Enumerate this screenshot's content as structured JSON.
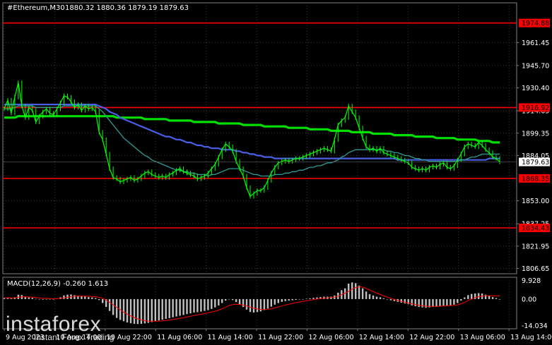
{
  "header": {
    "symbol_label": "#Ethereum,M30",
    "ohlc": "1880.32 1880.36 1879.19 1879.63"
  },
  "colors": {
    "background": "#000000",
    "candle": "#00ff00",
    "ma_fast": "#2f9b96",
    "ma_mid": "#4b5fe6",
    "ma_slow": "#00e000",
    "level": "#ff0000",
    "macd_hist": "#c0c0c0",
    "macd_signal": "#ff0000"
  },
  "chart_data": [
    {
      "type": "line",
      "title": "",
      "price_axis_ticks": [
        "1961.45",
        "1945.70",
        "1930.40",
        "1914.65",
        "1899.35",
        "1884.05",
        "1853.00",
        "1837.25",
        "1821.95",
        "1806.65"
      ],
      "time_axis_labels": [
        "9 Aug 2023",
        "10 Aug 14:00",
        "10 Aug 22:00",
        "11 Aug 06:00",
        "11 Aug 14:00",
        "11 Aug 22:00",
        "12 Aug 06:00",
        "12 Aug 14:00",
        "12 Aug 22:00",
        "13 Aug 06:00",
        "13 Aug 14:00"
      ],
      "ylim": [
        1803,
        1980
      ],
      "levels": [
        {
          "label": "1974.88",
          "value": 1974.88
        },
        {
          "label": "1916.92",
          "value": 1916.92
        },
        {
          "label": "1868.35",
          "value": 1868.35
        },
        {
          "label": "1834.43",
          "value": 1834.43
        }
      ],
      "current_price": {
        "label": "1879.63",
        "value": 1879.63
      },
      "series": [
        {
          "key": "close",
          "values": [
            1916,
            1922,
            1913,
            1924,
            1934,
            1918,
            1910,
            1917,
            1915,
            1907,
            1911,
            1914,
            1916,
            1913,
            1912,
            1916,
            1920,
            1925,
            1924,
            1921,
            1917,
            1919,
            1915,
            1918,
            1916,
            1917,
            1914,
            1900,
            1895,
            1885,
            1875,
            1869,
            1868,
            1866,
            1867,
            1868,
            1869,
            1867,
            1868,
            1870,
            1872,
            1873,
            1871,
            1870,
            1869,
            1870,
            1869,
            1871,
            1872,
            1874,
            1875,
            1873,
            1872,
            1871,
            1870,
            1868,
            1869,
            1870,
            1872,
            1875,
            1878,
            1883,
            1888,
            1892,
            1890,
            1887,
            1880,
            1875,
            1870,
            1862,
            1856,
            1858,
            1860,
            1860,
            1862,
            1867,
            1872,
            1876,
            1879,
            1880,
            1881,
            1880,
            1881,
            1882,
            1882,
            1883,
            1884,
            1885,
            1886,
            1887,
            1888,
            1889,
            1888,
            1887,
            1895,
            1905,
            1908,
            1910,
            1918,
            1914,
            1910,
            1903,
            1896,
            1890,
            1888,
            1889,
            1887,
            1889,
            1886,
            1885,
            1884,
            1883,
            1882,
            1881,
            1880,
            1879,
            1876,
            1875,
            1874,
            1875,
            1874,
            1876,
            1877,
            1876,
            1878,
            1879,
            1876,
            1875,
            1877,
            1881,
            1885,
            1890,
            1892,
            1891,
            1890,
            1893,
            1891,
            1888,
            1886,
            1883,
            1882,
            1879.63
          ]
        },
        {
          "key": "ma_fast",
          "values": [
            1916,
            1916,
            1916,
            1917,
            1918,
            1918,
            1918,
            1918,
            1918,
            1917,
            1917,
            1917,
            1917,
            1917,
            1917,
            1917,
            1917,
            1918,
            1918,
            1918,
            1918,
            1918,
            1918,
            1918,
            1918,
            1918,
            1918,
            1916,
            1914,
            1911,
            1908,
            1905,
            1902,
            1899,
            1896,
            1894,
            1892,
            1890,
            1888,
            1886,
            1884,
            1883,
            1881,
            1880,
            1879,
            1878,
            1877,
            1876,
            1875,
            1874,
            1874,
            1873,
            1873,
            1872,
            1872,
            1871,
            1871,
            1871,
            1870,
            1871,
            1871,
            1872,
            1873,
            1874,
            1875,
            1875,
            1875,
            1875,
            1874,
            1873,
            1872,
            1871,
            1871,
            1870,
            1870,
            1870,
            1870,
            1871,
            1871,
            1871,
            1872,
            1872,
            1873,
            1873,
            1874,
            1874,
            1875,
            1876,
            1876,
            1877,
            1877,
            1878,
            1879,
            1879,
            1880,
            1881,
            1883,
            1884,
            1886,
            1887,
            1888,
            1888,
            1888,
            1888,
            1888,
            1888,
            1888,
            1888,
            1888,
            1887,
            1887,
            1886,
            1886,
            1885,
            1884,
            1884,
            1883,
            1882,
            1882,
            1881,
            1881,
            1880,
            1880,
            1880,
            1880,
            1880,
            1880,
            1880,
            1880,
            1880,
            1881,
            1881,
            1882,
            1883,
            1883,
            1884,
            1885,
            1885,
            1885,
            1885,
            1885,
            1885
          ]
        },
        {
          "key": "ma_mid",
          "values": [
            1919,
            1919,
            1919,
            1919,
            1919,
            1919,
            1919,
            1919,
            1919,
            1919,
            1919,
            1919,
            1919,
            1919,
            1919,
            1919,
            1919,
            1919,
            1919,
            1919,
            1919,
            1919,
            1919,
            1919,
            1919,
            1919,
            1919,
            1918,
            1917,
            1916,
            1914,
            1913,
            1912,
            1910,
            1909,
            1908,
            1907,
            1906,
            1905,
            1904,
            1903,
            1902,
            1901,
            1900,
            1899,
            1898,
            1897,
            1897,
            1896,
            1895,
            1895,
            1894,
            1893,
            1893,
            1892,
            1891,
            1891,
            1890,
            1890,
            1889,
            1889,
            1889,
            1888,
            1888,
            1888,
            1888,
            1887,
            1887,
            1886,
            1886,
            1885,
            1885,
            1884,
            1884,
            1883,
            1883,
            1883,
            1882,
            1882,
            1882,
            1882,
            1882,
            1882,
            1882,
            1882,
            1882,
            1882,
            1882,
            1882,
            1882,
            1882,
            1882,
            1882,
            1882,
            1882,
            1882,
            1882,
            1882,
            1882,
            1882,
            1882,
            1882,
            1882,
            1882,
            1882,
            1882,
            1882,
            1882,
            1882,
            1882,
            1882,
            1882,
            1881,
            1881,
            1881,
            1881,
            1881,
            1881,
            1881,
            1881,
            1881,
            1881,
            1881,
            1881,
            1881,
            1881,
            1881,
            1881,
            1881,
            1881,
            1881,
            1881,
            1881,
            1881,
            1881,
            1881,
            1881,
            1881,
            1882,
            1882,
            1882,
            1882
          ]
        },
        {
          "key": "ma_slow",
          "values": [
            1910,
            1910,
            1910,
            1910,
            1911,
            1911,
            1911,
            1911,
            1911,
            1911,
            1911,
            1911,
            1911,
            1911,
            1911,
            1911,
            1911,
            1911,
            1911,
            1911,
            1911,
            1911,
            1911,
            1911,
            1911,
            1911,
            1911,
            1911,
            1911,
            1911,
            1911,
            1911,
            1910,
            1910,
            1910,
            1910,
            1910,
            1910,
            1910,
            1910,
            1909,
            1909,
            1909,
            1909,
            1909,
            1909,
            1909,
            1908,
            1908,
            1908,
            1908,
            1908,
            1908,
            1908,
            1907,
            1907,
            1907,
            1907,
            1907,
            1907,
            1907,
            1906,
            1906,
            1906,
            1906,
            1906,
            1906,
            1906,
            1905,
            1905,
            1905,
            1905,
            1905,
            1905,
            1904,
            1904,
            1904,
            1904,
            1904,
            1904,
            1904,
            1903,
            1903,
            1903,
            1903,
            1903,
            1903,
            1902,
            1902,
            1902,
            1902,
            1902,
            1902,
            1901,
            1901,
            1901,
            1901,
            1901,
            1901,
            1900,
            1900,
            1900,
            1900,
            1900,
            1900,
            1899,
            1899,
            1899,
            1899,
            1899,
            1899,
            1898,
            1898,
            1898,
            1898,
            1898,
            1898,
            1897,
            1897,
            1897,
            1897,
            1897,
            1897,
            1896,
            1896,
            1896,
            1896,
            1896,
            1896,
            1895,
            1895,
            1895,
            1895,
            1895,
            1895,
            1894,
            1894,
            1894,
            1894,
            1893,
            1893,
            1893
          ]
        }
      ]
    },
    {
      "type": "bar",
      "title": "MACD(12,26,9) -0.260 1.613",
      "ticks": [
        "9.928",
        "0.00",
        "-14.034"
      ],
      "ylim": [
        -15,
        11
      ],
      "histogram": [
        0.5,
        0.8,
        0.3,
        0.9,
        2.2,
        2.0,
        1.2,
        0.8,
        0.6,
        0.1,
        -0.2,
        -0.3,
        -0.2,
        -0.1,
        0.0,
        0.3,
        0.9,
        1.8,
        2.2,
        2.3,
        2.0,
        1.6,
        1.4,
        1.3,
        1.0,
        0.8,
        0.5,
        -0.5,
        -2.0,
        -4.0,
        -6.0,
        -8.0,
        -9.5,
        -10.5,
        -11.2,
        -11.8,
        -12.2,
        -12.5,
        -12.6,
        -12.5,
        -12.3,
        -12.0,
        -11.6,
        -11.2,
        -10.8,
        -10.4,
        -10.0,
        -9.6,
        -9.2,
        -8.8,
        -8.4,
        -8.0,
        -7.6,
        -7.2,
        -6.8,
        -6.6,
        -6.3,
        -6.0,
        -5.6,
        -5.0,
        -4.2,
        -3.2,
        -2.0,
        -0.8,
        -0.2,
        -0.5,
        -1.5,
        -2.8,
        -4.0,
        -5.3,
        -6.5,
        -6.8,
        -6.6,
        -6.2,
        -5.6,
        -4.8,
        -3.8,
        -2.8,
        -2.0,
        -1.4,
        -1.0,
        -0.8,
        -0.6,
        -0.4,
        -0.2,
        0.0,
        0.2,
        0.4,
        0.6,
        0.8,
        1.0,
        1.2,
        1.2,
        1.2,
        1.8,
        3.2,
        4.5,
        5.4,
        7.8,
        8.4,
        8.0,
        6.8,
        5.4,
        3.8,
        2.5,
        1.8,
        1.2,
        0.9,
        0.4,
        -0.1,
        -0.6,
        -1.0,
        -1.4,
        -1.8,
        -2.2,
        -2.6,
        -3.2,
        -3.6,
        -4.0,
        -4.2,
        -4.4,
        -4.2,
        -4.0,
        -3.9,
        -3.6,
        -3.3,
        -3.2,
        -3.1,
        -2.8,
        -2.0,
        -0.8,
        0.8,
        2.0,
        2.6,
        2.8,
        3.0,
        2.8,
        2.2,
        1.6,
        1.0,
        0.5,
        -0.26
      ],
      "signal": [
        0.6,
        0.65,
        0.6,
        0.65,
        0.9,
        1.1,
        1.1,
        1.05,
        1.0,
        0.8,
        0.6,
        0.4,
        0.3,
        0.2,
        0.15,
        0.2,
        0.3,
        0.6,
        0.9,
        1.2,
        1.4,
        1.5,
        1.5,
        1.5,
        1.4,
        1.3,
        1.2,
        0.9,
        0.4,
        -0.5,
        -1.6,
        -2.9,
        -4.2,
        -5.4,
        -6.6,
        -7.6,
        -8.5,
        -9.3,
        -10.0,
        -10.5,
        -10.9,
        -11.1,
        -11.2,
        -11.2,
        -11.1,
        -11.0,
        -10.8,
        -10.6,
        -10.3,
        -10.0,
        -9.7,
        -9.4,
        -9.0,
        -8.7,
        -8.3,
        -8.0,
        -7.7,
        -7.3,
        -7.0,
        -6.6,
        -6.1,
        -5.6,
        -4.9,
        -4.1,
        -3.3,
        -2.8,
        -2.6,
        -2.7,
        -3.0,
        -3.5,
        -4.1,
        -4.6,
        -5.0,
        -5.2,
        -5.3,
        -5.2,
        -4.9,
        -4.5,
        -4.0,
        -3.5,
        -3.0,
        -2.6,
        -2.2,
        -1.8,
        -1.5,
        -1.2,
        -0.9,
        -0.6,
        -0.3,
        0.0,
        0.2,
        0.4,
        0.6,
        0.8,
        1.0,
        1.5,
        2.2,
        3.0,
        3.9,
        5.0,
        5.8,
        6.2,
        6.0,
        5.4,
        4.6,
        3.8,
        3.0,
        2.3,
        1.6,
        1.0,
        0.4,
        -0.2,
        -0.7,
        -1.2,
        -1.6,
        -2.0,
        -2.4,
        -2.8,
        -3.1,
        -3.4,
        -3.6,
        -3.7,
        -3.7,
        -3.7,
        -3.6,
        -3.5,
        -3.4,
        -3.3,
        -3.2,
        -2.9,
        -2.4,
        -1.7,
        -0.8,
        0.0,
        0.7,
        1.2,
        1.5,
        1.7,
        1.7,
        1.6,
        1.6,
        1.613
      ]
    }
  ],
  "watermark": {
    "name": "instaforex",
    "subtitle": "Instant Forex Trading"
  }
}
